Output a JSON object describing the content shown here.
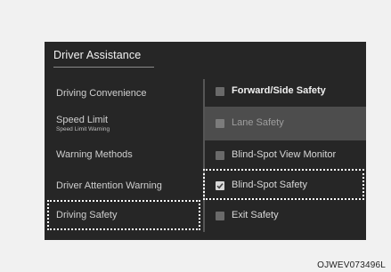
{
  "screen": {
    "title": "Driver Assistance",
    "left_menu": [
      {
        "label": "Driving Convenience"
      },
      {
        "label": "Speed Limit",
        "sub": "Speed Limit Warning"
      },
      {
        "label": "Warning Methods"
      },
      {
        "label": "Driver Attention Warning"
      },
      {
        "label": "Driving Safety"
      }
    ],
    "right_options": [
      {
        "label": "Forward/Side Safety",
        "checked": false
      },
      {
        "label": "Lane Safety",
        "checked": false
      },
      {
        "label": "Blind-Spot View Monitor",
        "checked": false
      },
      {
        "label": "Blind-Spot Safety",
        "checked": true
      },
      {
        "label": "Exit Safety",
        "checked": false
      }
    ]
  },
  "caption": "OJWEV073496L",
  "colors": {
    "background": "#262626",
    "highlight": "#4d4d4d",
    "dotted_outline": "#ffffff"
  }
}
